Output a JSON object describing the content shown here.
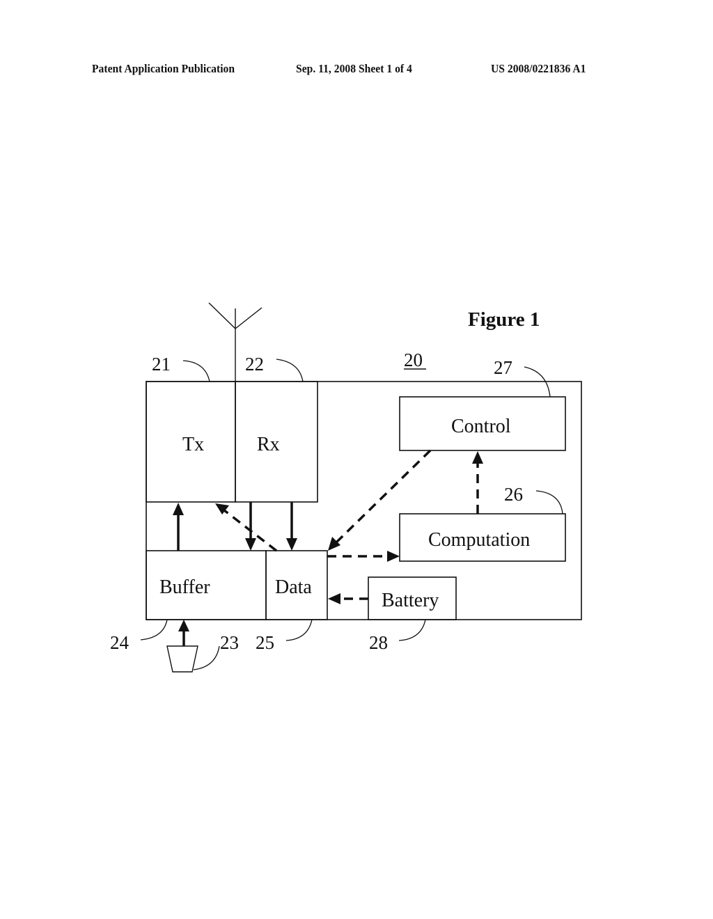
{
  "header": {
    "publication_type": "Patent Application Publication",
    "date_sheet": "Sep. 11, 2008   Sheet 1 of 4",
    "publication_number": "US 2008/0221836 A1"
  },
  "figure": {
    "title": "Figure 1",
    "device_ref": "20",
    "blocks": {
      "tx": "Tx",
      "rx": "Rx",
      "buffer": "Buffer",
      "data": "Data",
      "control": "Control",
      "computation": "Computation",
      "battery": "Battery"
    },
    "refs": {
      "tx": "21",
      "rx": "22",
      "sensor": "23",
      "buffer": "24",
      "data": "25",
      "computation": "26",
      "control": "27",
      "battery": "28"
    },
    "connections": [
      {
        "from": "buffer",
        "to": "tx",
        "style": "solid"
      },
      {
        "from": "rx",
        "to": "buffer",
        "style": "solid"
      },
      {
        "from": "rx",
        "to": "data",
        "style": "solid"
      },
      {
        "from": "data",
        "to": "tx",
        "style": "dashed"
      },
      {
        "from": "control",
        "to": "data",
        "style": "dashed"
      },
      {
        "from": "data",
        "to": "computation",
        "style": "dashed"
      },
      {
        "from": "computation",
        "to": "control",
        "style": "dashed"
      },
      {
        "from": "battery",
        "to": "data",
        "style": "dashed"
      },
      {
        "from": "sensor",
        "to": "buffer",
        "style": "solid"
      }
    ]
  }
}
